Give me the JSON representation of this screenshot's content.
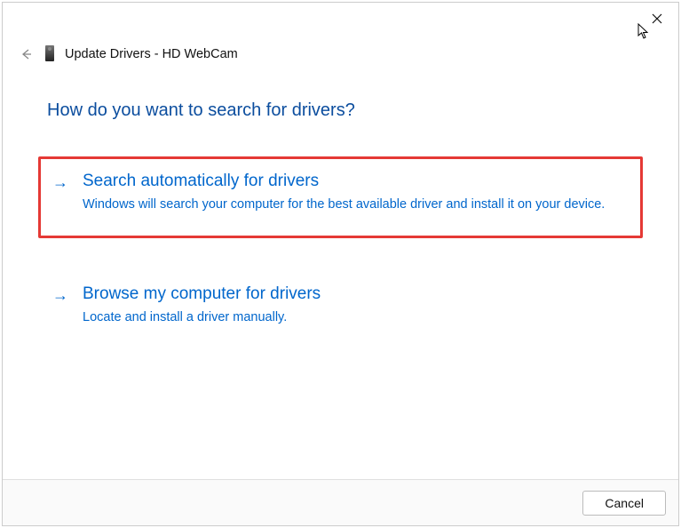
{
  "header": {
    "title": "Update Drivers - HD WebCam"
  },
  "heading": "How do you want to search for drivers?",
  "options": [
    {
      "title": "Search automatically for drivers",
      "desc": "Windows will search your computer for the best available driver and install it on your device."
    },
    {
      "title": "Browse my computer for drivers",
      "desc": "Locate and install a driver manually."
    }
  ],
  "footer": {
    "cancel_label": "Cancel"
  }
}
